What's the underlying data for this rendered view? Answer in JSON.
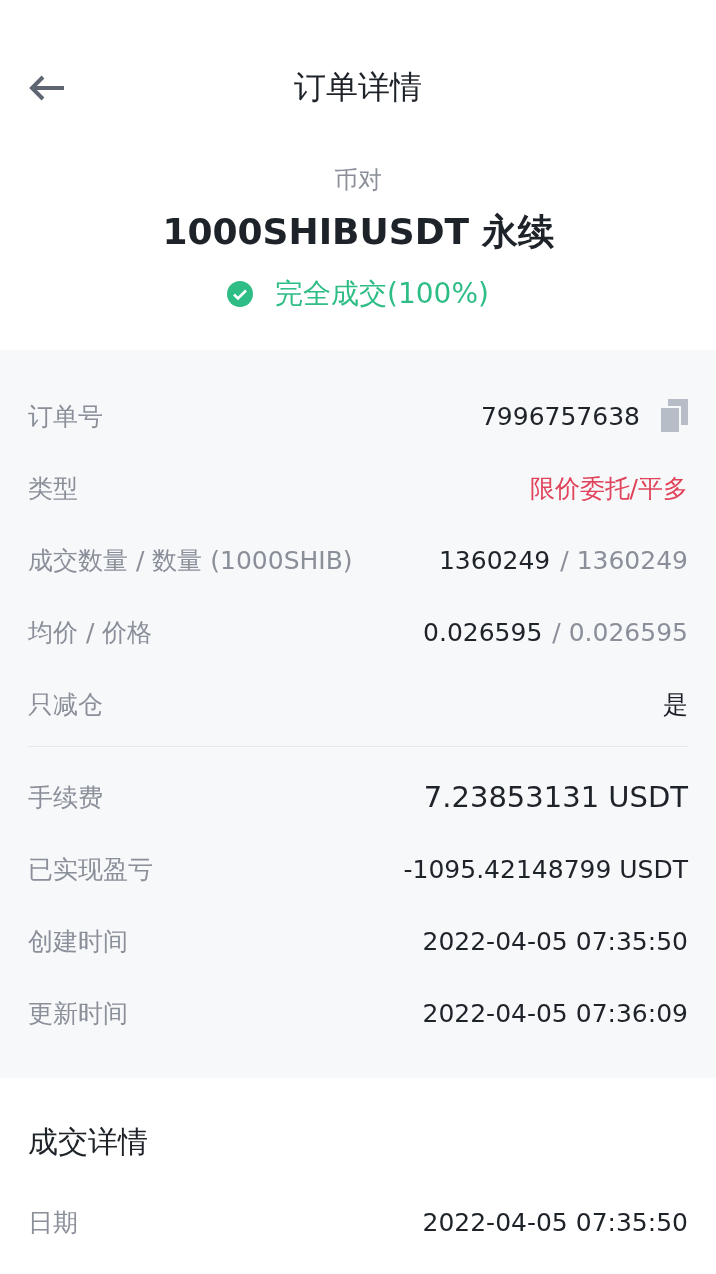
{
  "header": {
    "title": "订单详情"
  },
  "pair": {
    "label": "币对",
    "symbol": "1000SHIBUSDT 永续",
    "status": {
      "kind": "filled",
      "text": "完全成交(100%)"
    }
  },
  "details": {
    "groups": [
      {
        "rows": [
          {
            "kind": "copy",
            "label": "订单号",
            "value": "7996757638"
          },
          {
            "kind": "accent",
            "label": "类型",
            "value": "限价委托/平多"
          },
          {
            "kind": "pair",
            "label": "成交数量 / 数量 (1000SHIB)",
            "value": "1360249",
            "secondary": "/ 1360249"
          },
          {
            "kind": "pair",
            "label": "均价 / 价格",
            "value": "0.026595",
            "secondary": "/ 0.026595"
          },
          {
            "kind": "plain",
            "label": "只减仓",
            "value": "是"
          }
        ]
      },
      {
        "rows": [
          {
            "kind": "large",
            "label": "手续费",
            "value": "7.23853131 USDT"
          },
          {
            "kind": "plain",
            "label": "已实现盈亏",
            "value": "-1095.42148799 USDT"
          },
          {
            "kind": "plain",
            "label": "创建时间",
            "value": "2022-04-05 07:35:50"
          },
          {
            "kind": "plain",
            "label": "更新时间",
            "value": "2022-04-05 07:36:09"
          }
        ]
      }
    ]
  },
  "trades": {
    "title": "成交详情",
    "rows": [
      {
        "label": "日期",
        "value": "2022-04-05 07:35:50"
      }
    ]
  }
}
